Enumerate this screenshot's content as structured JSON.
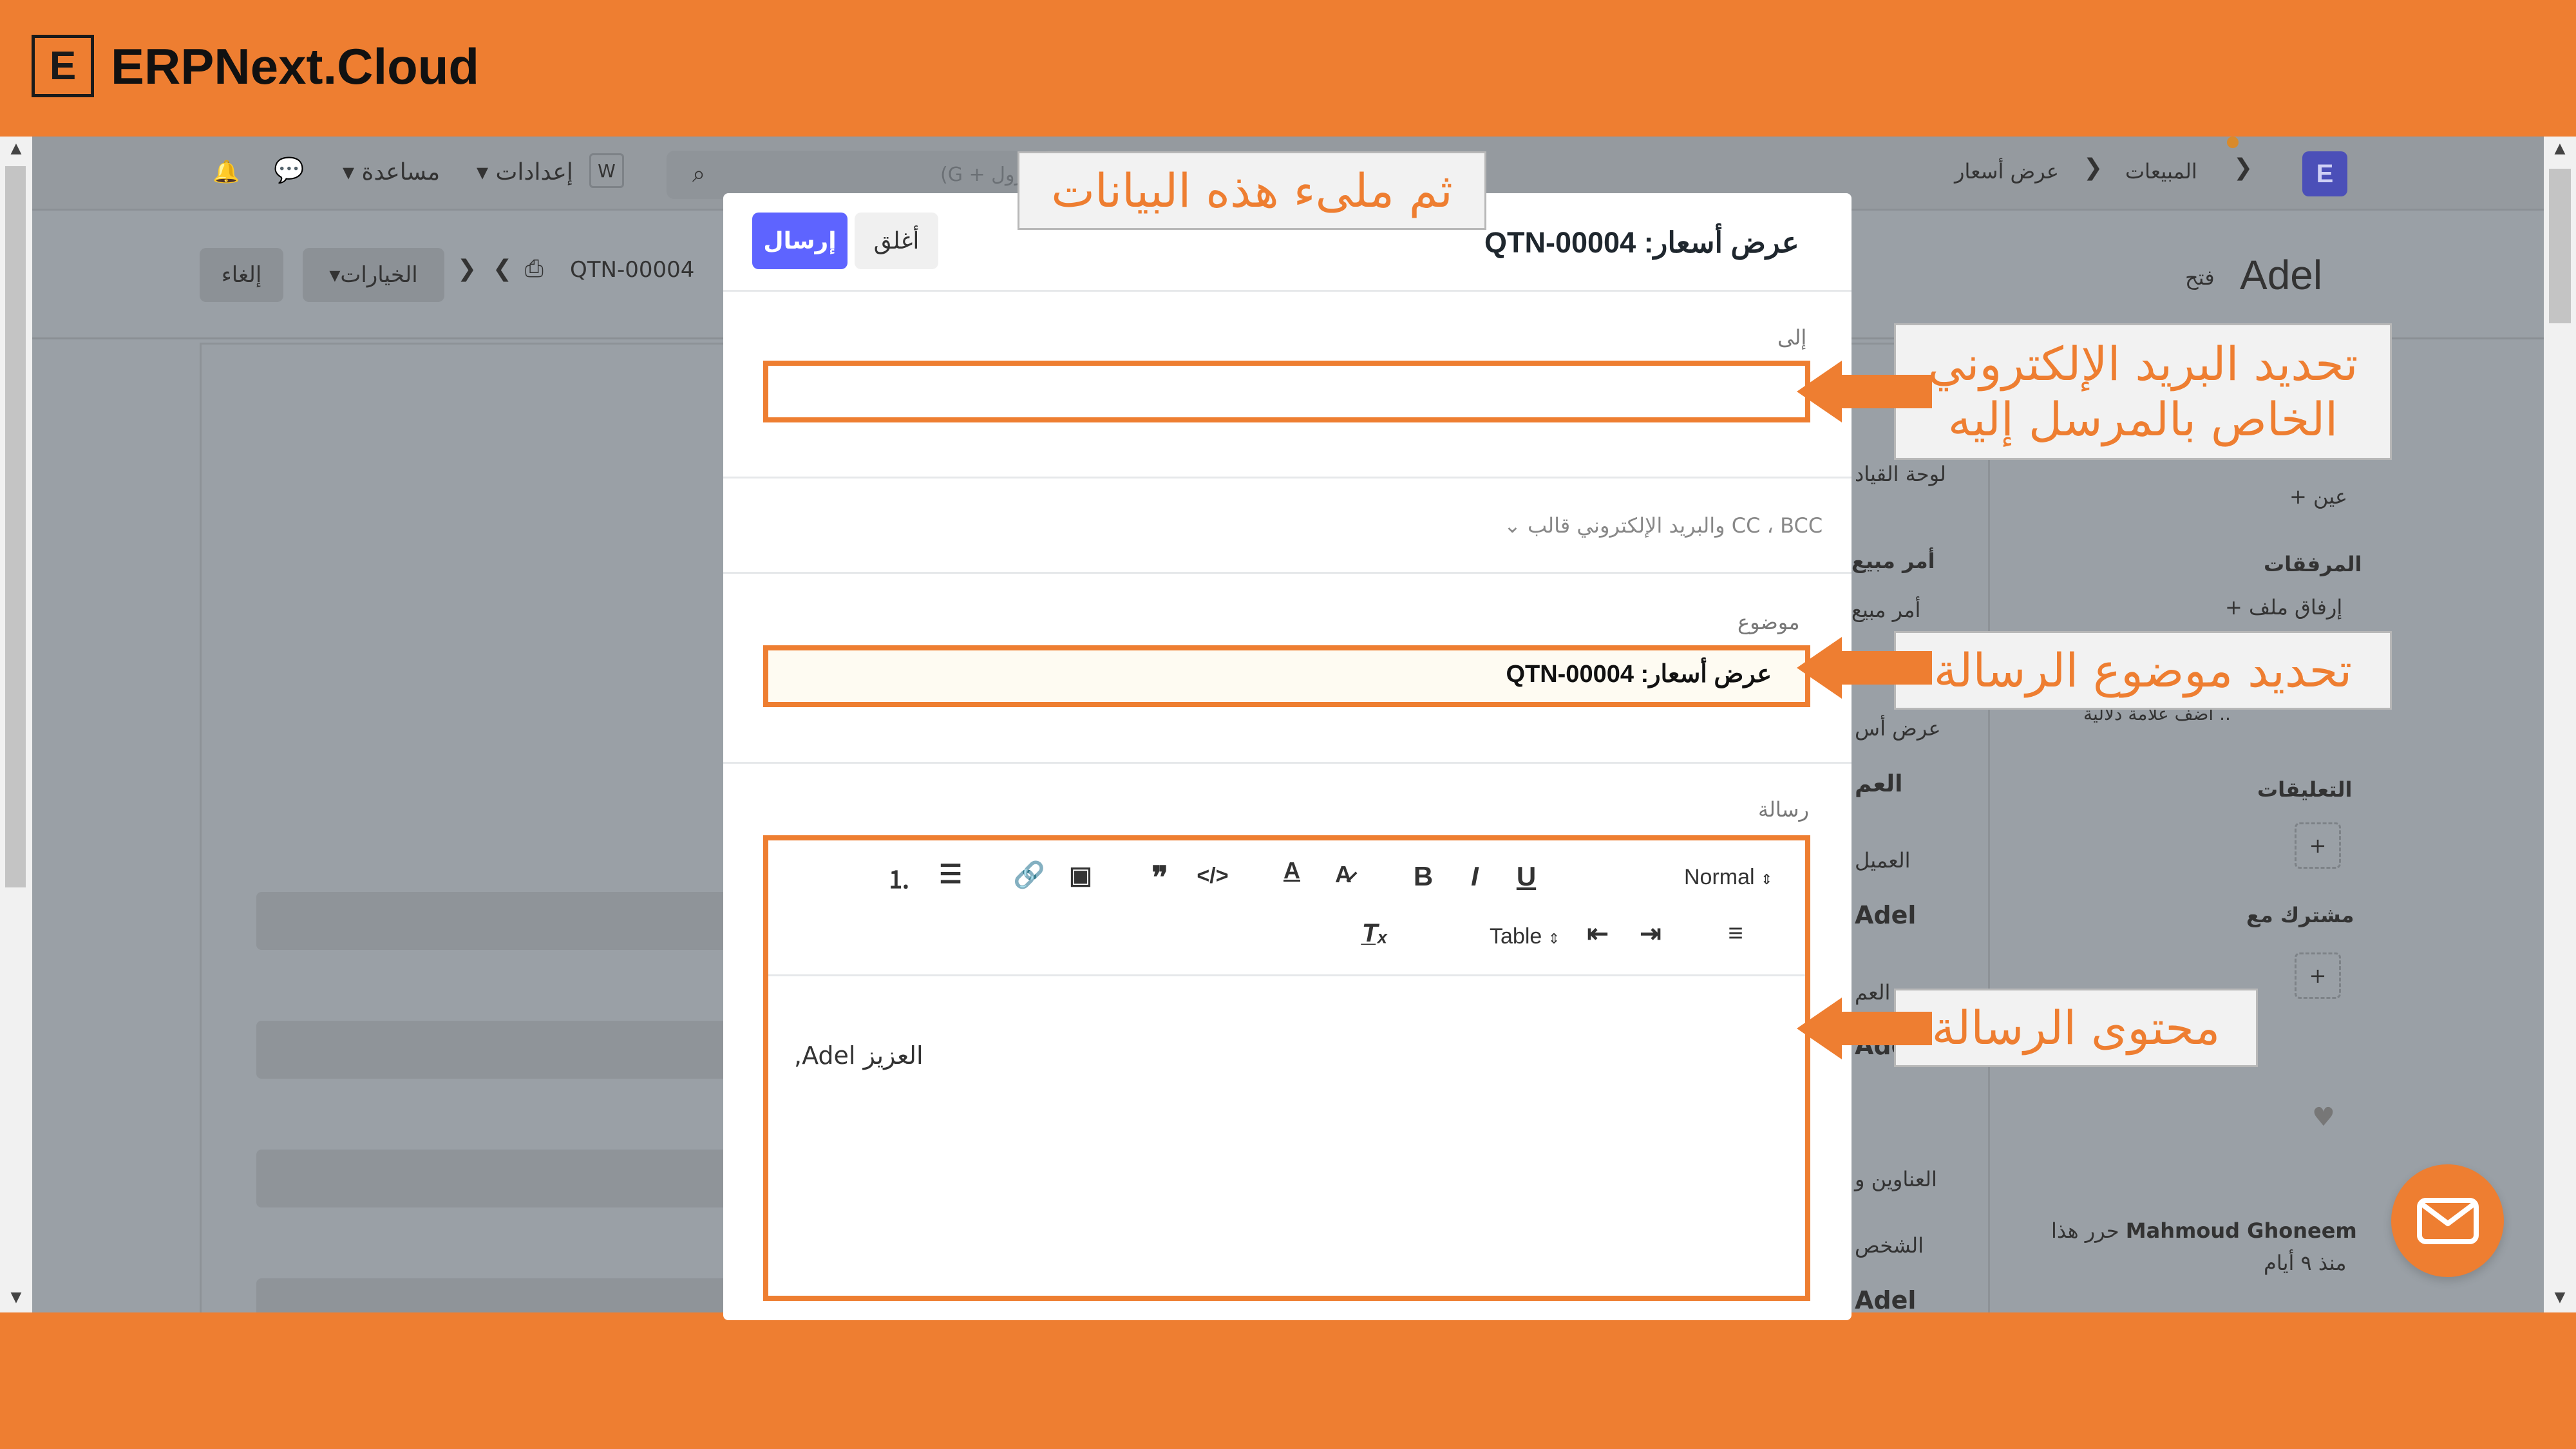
{
  "brand": {
    "logo_letter": "E",
    "name": "ERPNext.Cloud"
  },
  "navbar": {
    "breadcrumb_sales": "المبيعات",
    "breadcrumb_quotation": "عرض أسعار",
    "search_placeholder": "(G + كنترول",
    "settings_label": "إعدادات",
    "help_label": "مساعدة",
    "w_badge": "W",
    "app_badge": "E"
  },
  "page": {
    "title": "Adel",
    "status": "فتح",
    "doc_id": "QTN-00004",
    "options_label": "الخيارات",
    "cancel_label": "إلغاء"
  },
  "sidebar": {
    "assign_add": "عين",
    "attachments": "المرفقات",
    "attach_file": "إرفاق ملف",
    "add_tag": "أضف علامة دلالية ..",
    "comments": "التعليقات",
    "shared_with": "مشترك مع",
    "editor_name": "Mahmoud Ghoneem",
    "edited_this": "حرر هذا",
    "edited_ago": "منذ ٩ أيام"
  },
  "behind_form": {
    "dashboard": "لوحة القياد",
    "sales_order_1": "أمر مبيع",
    "sales_order_2": "أمر مبيع",
    "quotation": "عرض أس",
    "customer_heading": "العم",
    "customer_label": "العميل",
    "customer_value": "Adel",
    "customer_name_label": "م العم",
    "customer_name_value": "Adel",
    "addresses": "العناوين و",
    "contact": "الشخص",
    "contact_value": "Adel"
  },
  "modal": {
    "title": "عرض أسعار: QTN-00004",
    "send_label": "إرسال",
    "close_label": "أغلق",
    "to_label": "إلى",
    "to_value": "",
    "cc_link": "CC ، BCC والبريد الإلكتروني قالب",
    "subject_label": "موضوع",
    "subject_value": "عرض أسعار: QTN-00004",
    "message_label": "رسالة",
    "editor": {
      "heading_select": "Normal",
      "table_label": "Table",
      "content": "العزيز Adel,"
    }
  },
  "callouts": {
    "fill_data": "ثم ملىء هذه البيانات",
    "recipient_line1": "تحديد البريد الإلكتروني",
    "recipient_line2": "الخاص بالمرسل إليه",
    "subject": "تحديد موضوع الرسالة",
    "content": "محتوى الرسالة"
  },
  "colors": {
    "accent": "#EE7E31",
    "primary_button": "#5E64FF",
    "overlay": "#9AA0A6"
  }
}
